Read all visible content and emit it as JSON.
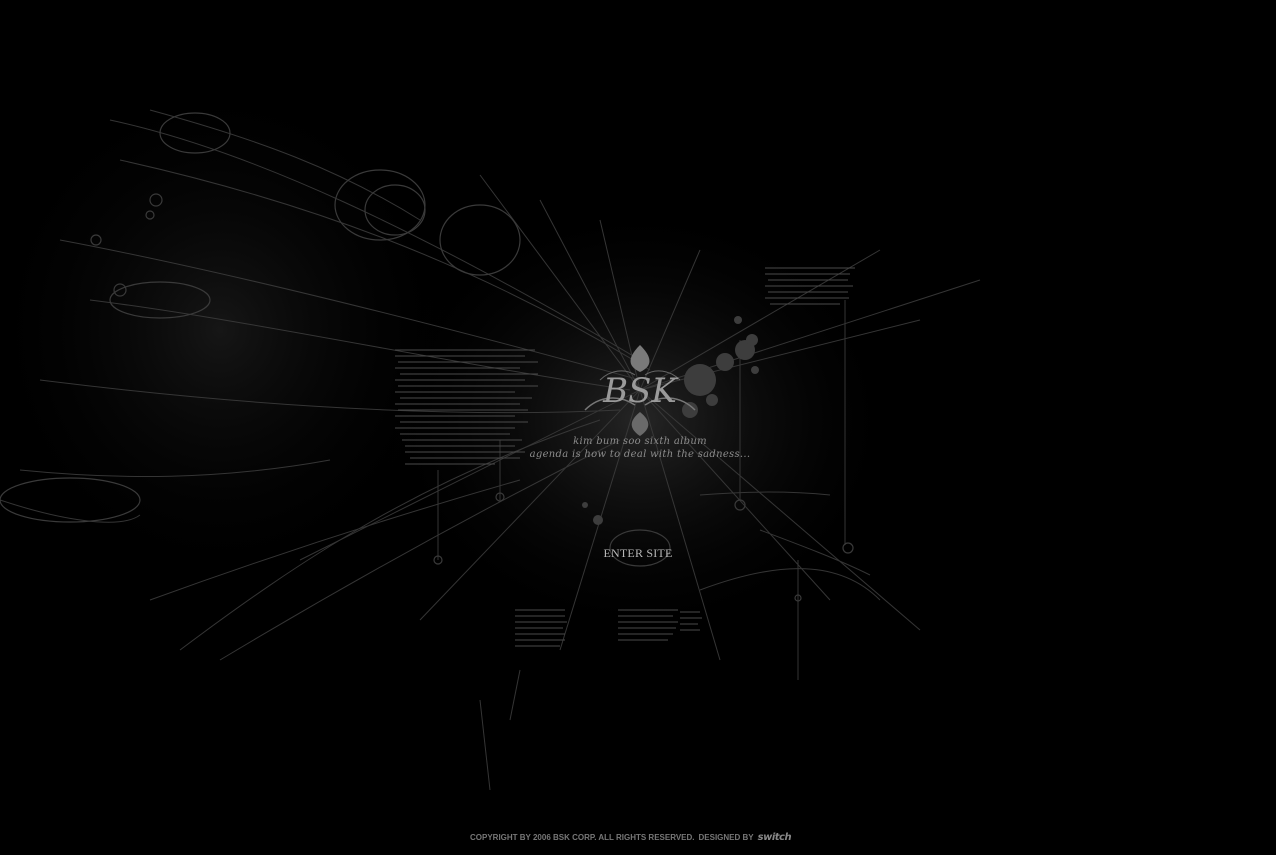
{
  "logo": {
    "text": "BSK"
  },
  "tagline": {
    "line1": "kim bum soo sixth album",
    "line2": "agenda is how to deal with the sadness..."
  },
  "enter_site_label": "ENTER SITE",
  "footer": {
    "copyright": "COPYRIGHT BY 2006 BSK CORP. ALL RIGHTS RESERVED.",
    "designed_by_label": "DESIGNED BY",
    "designer_name": "switch"
  },
  "colors": {
    "background": "#000000",
    "sketch_lines": "#3a3a3a",
    "text_primary": "#b8b8b8",
    "footer_text": "#777777"
  },
  "icons": {
    "logo_ornament": "bsk-ornament-icon",
    "ink_splatter": "ink-splatter-icon"
  }
}
